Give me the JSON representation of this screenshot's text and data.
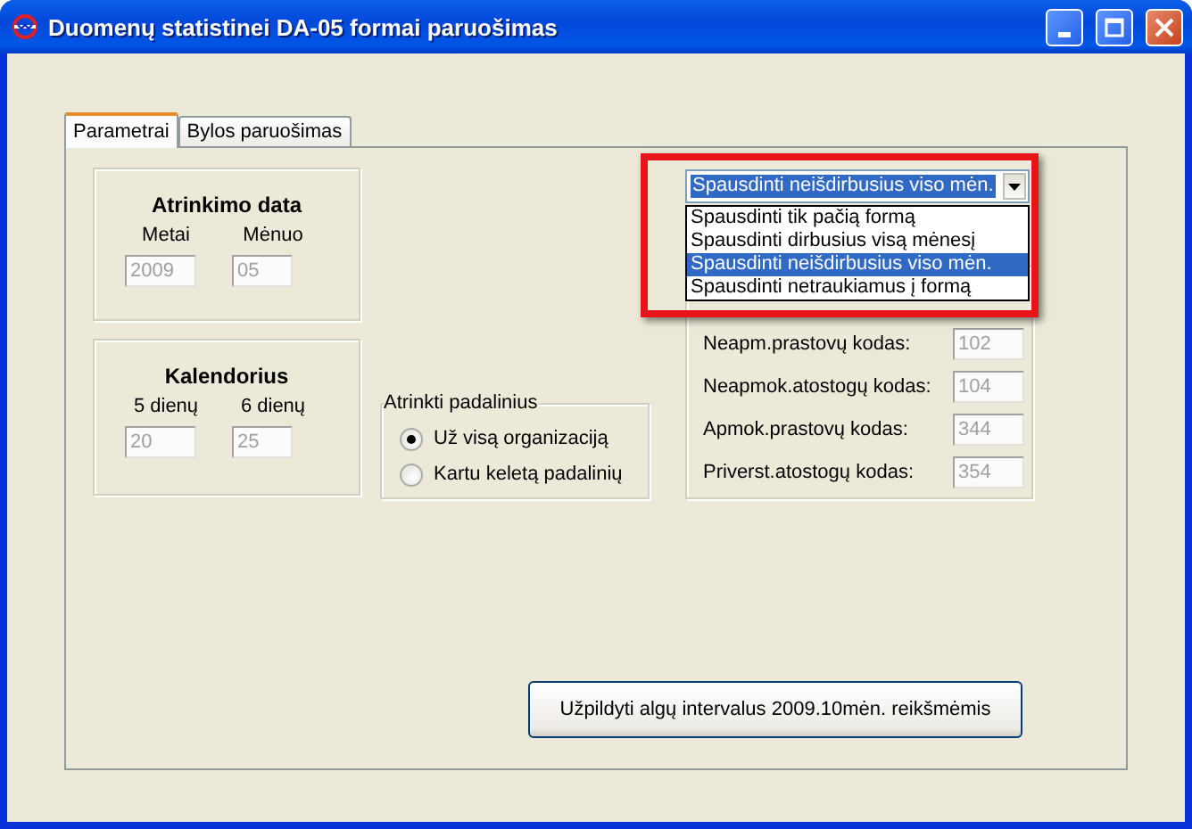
{
  "window": {
    "title": "Duomenų statistinei DA-05 formai paruošimas"
  },
  "tabs": [
    {
      "label": "Parametrai",
      "selected": true
    },
    {
      "label": "Bylos paruošimas",
      "selected": false
    }
  ],
  "date_group": {
    "title": "Atrinkimo data",
    "fields": [
      {
        "label": "Metai",
        "value": "2009",
        "disabled": true
      },
      {
        "label": "Mėnuo",
        "value": "05",
        "disabled": true
      }
    ]
  },
  "calendar_group": {
    "title": "Kalendorius",
    "fields": [
      {
        "label": "5 dienų",
        "value": "20",
        "disabled": true
      },
      {
        "label": "6 dienų",
        "value": "25",
        "disabled": true
      }
    ]
  },
  "units_group": {
    "title": "Atrinkti padalinius",
    "options": [
      {
        "label": "Už visą organizaciją",
        "selected": true
      },
      {
        "label": "Kartu keletą padalinių",
        "selected": false
      }
    ]
  },
  "print_dropdown": {
    "value": "Spausdinti neišdirbusius viso mėn.",
    "expanded": true,
    "options": [
      {
        "label": "Spausdinti tik pačią formą",
        "selected": false
      },
      {
        "label": "Spausdinti dirbusius visą mėnesį",
        "selected": false
      },
      {
        "label": "Spausdinti neišdirbusius viso mėn.",
        "selected": true
      },
      {
        "label": "Spausdinti netraukiamus į formą",
        "selected": false
      }
    ]
  },
  "codes_group": {
    "fields": [
      {
        "label": "Neapm.prastovų kodas:",
        "value": "102",
        "disabled": true
      },
      {
        "label": "Neapmok.atostogų kodas:",
        "value": "104",
        "disabled": true
      },
      {
        "label": "Apmok.prastovų kodas:",
        "value": "344",
        "disabled": true
      },
      {
        "label": "Priverst.atostogų kodas:",
        "value": "354",
        "disabled": true
      }
    ]
  },
  "fill_button": {
    "label": "Užpildyti algų intervalus 2009.10mėn. reikšmėmis"
  }
}
